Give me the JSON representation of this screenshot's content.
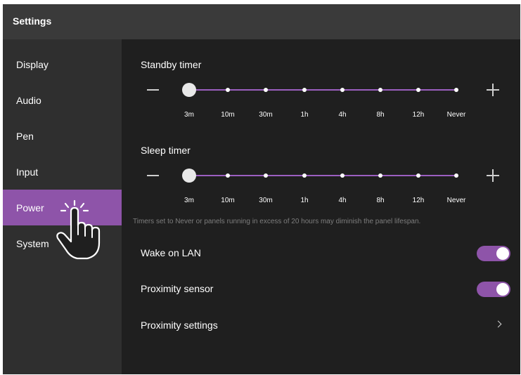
{
  "window": {
    "title": "Settings"
  },
  "sidebar": {
    "items": [
      {
        "label": "Display",
        "active": false
      },
      {
        "label": "Audio",
        "active": false
      },
      {
        "label": "Pen",
        "active": false
      },
      {
        "label": "Input",
        "active": false
      },
      {
        "label": "Power",
        "active": true
      },
      {
        "label": "System",
        "active": false
      }
    ]
  },
  "power": {
    "standby": {
      "title": "Standby timer",
      "ticks": [
        "3m",
        "10m",
        "30m",
        "1h",
        "4h",
        "8h",
        "12h",
        "Never"
      ],
      "selected": "3m"
    },
    "sleep": {
      "title": "Sleep timer",
      "ticks": [
        "3m",
        "10m",
        "30m",
        "1h",
        "4h",
        "8h",
        "12h",
        "Never"
      ],
      "selected": "3m"
    },
    "note": "Timers set to Never or panels running in excess of 20 hours may diminish the panel lifespan.",
    "wake_on_lan": {
      "label": "Wake on LAN",
      "enabled": true
    },
    "proximity_sensor": {
      "label": "Proximity sensor",
      "enabled": true
    },
    "proximity_settings": {
      "label": "Proximity settings"
    }
  },
  "colors": {
    "accent": "#8e54a9",
    "track": "#9b5fc0",
    "sidebar_bg": "#2f2f2f",
    "titlebar_bg": "#3a3a3a",
    "content_bg": "#1f1f1f"
  }
}
